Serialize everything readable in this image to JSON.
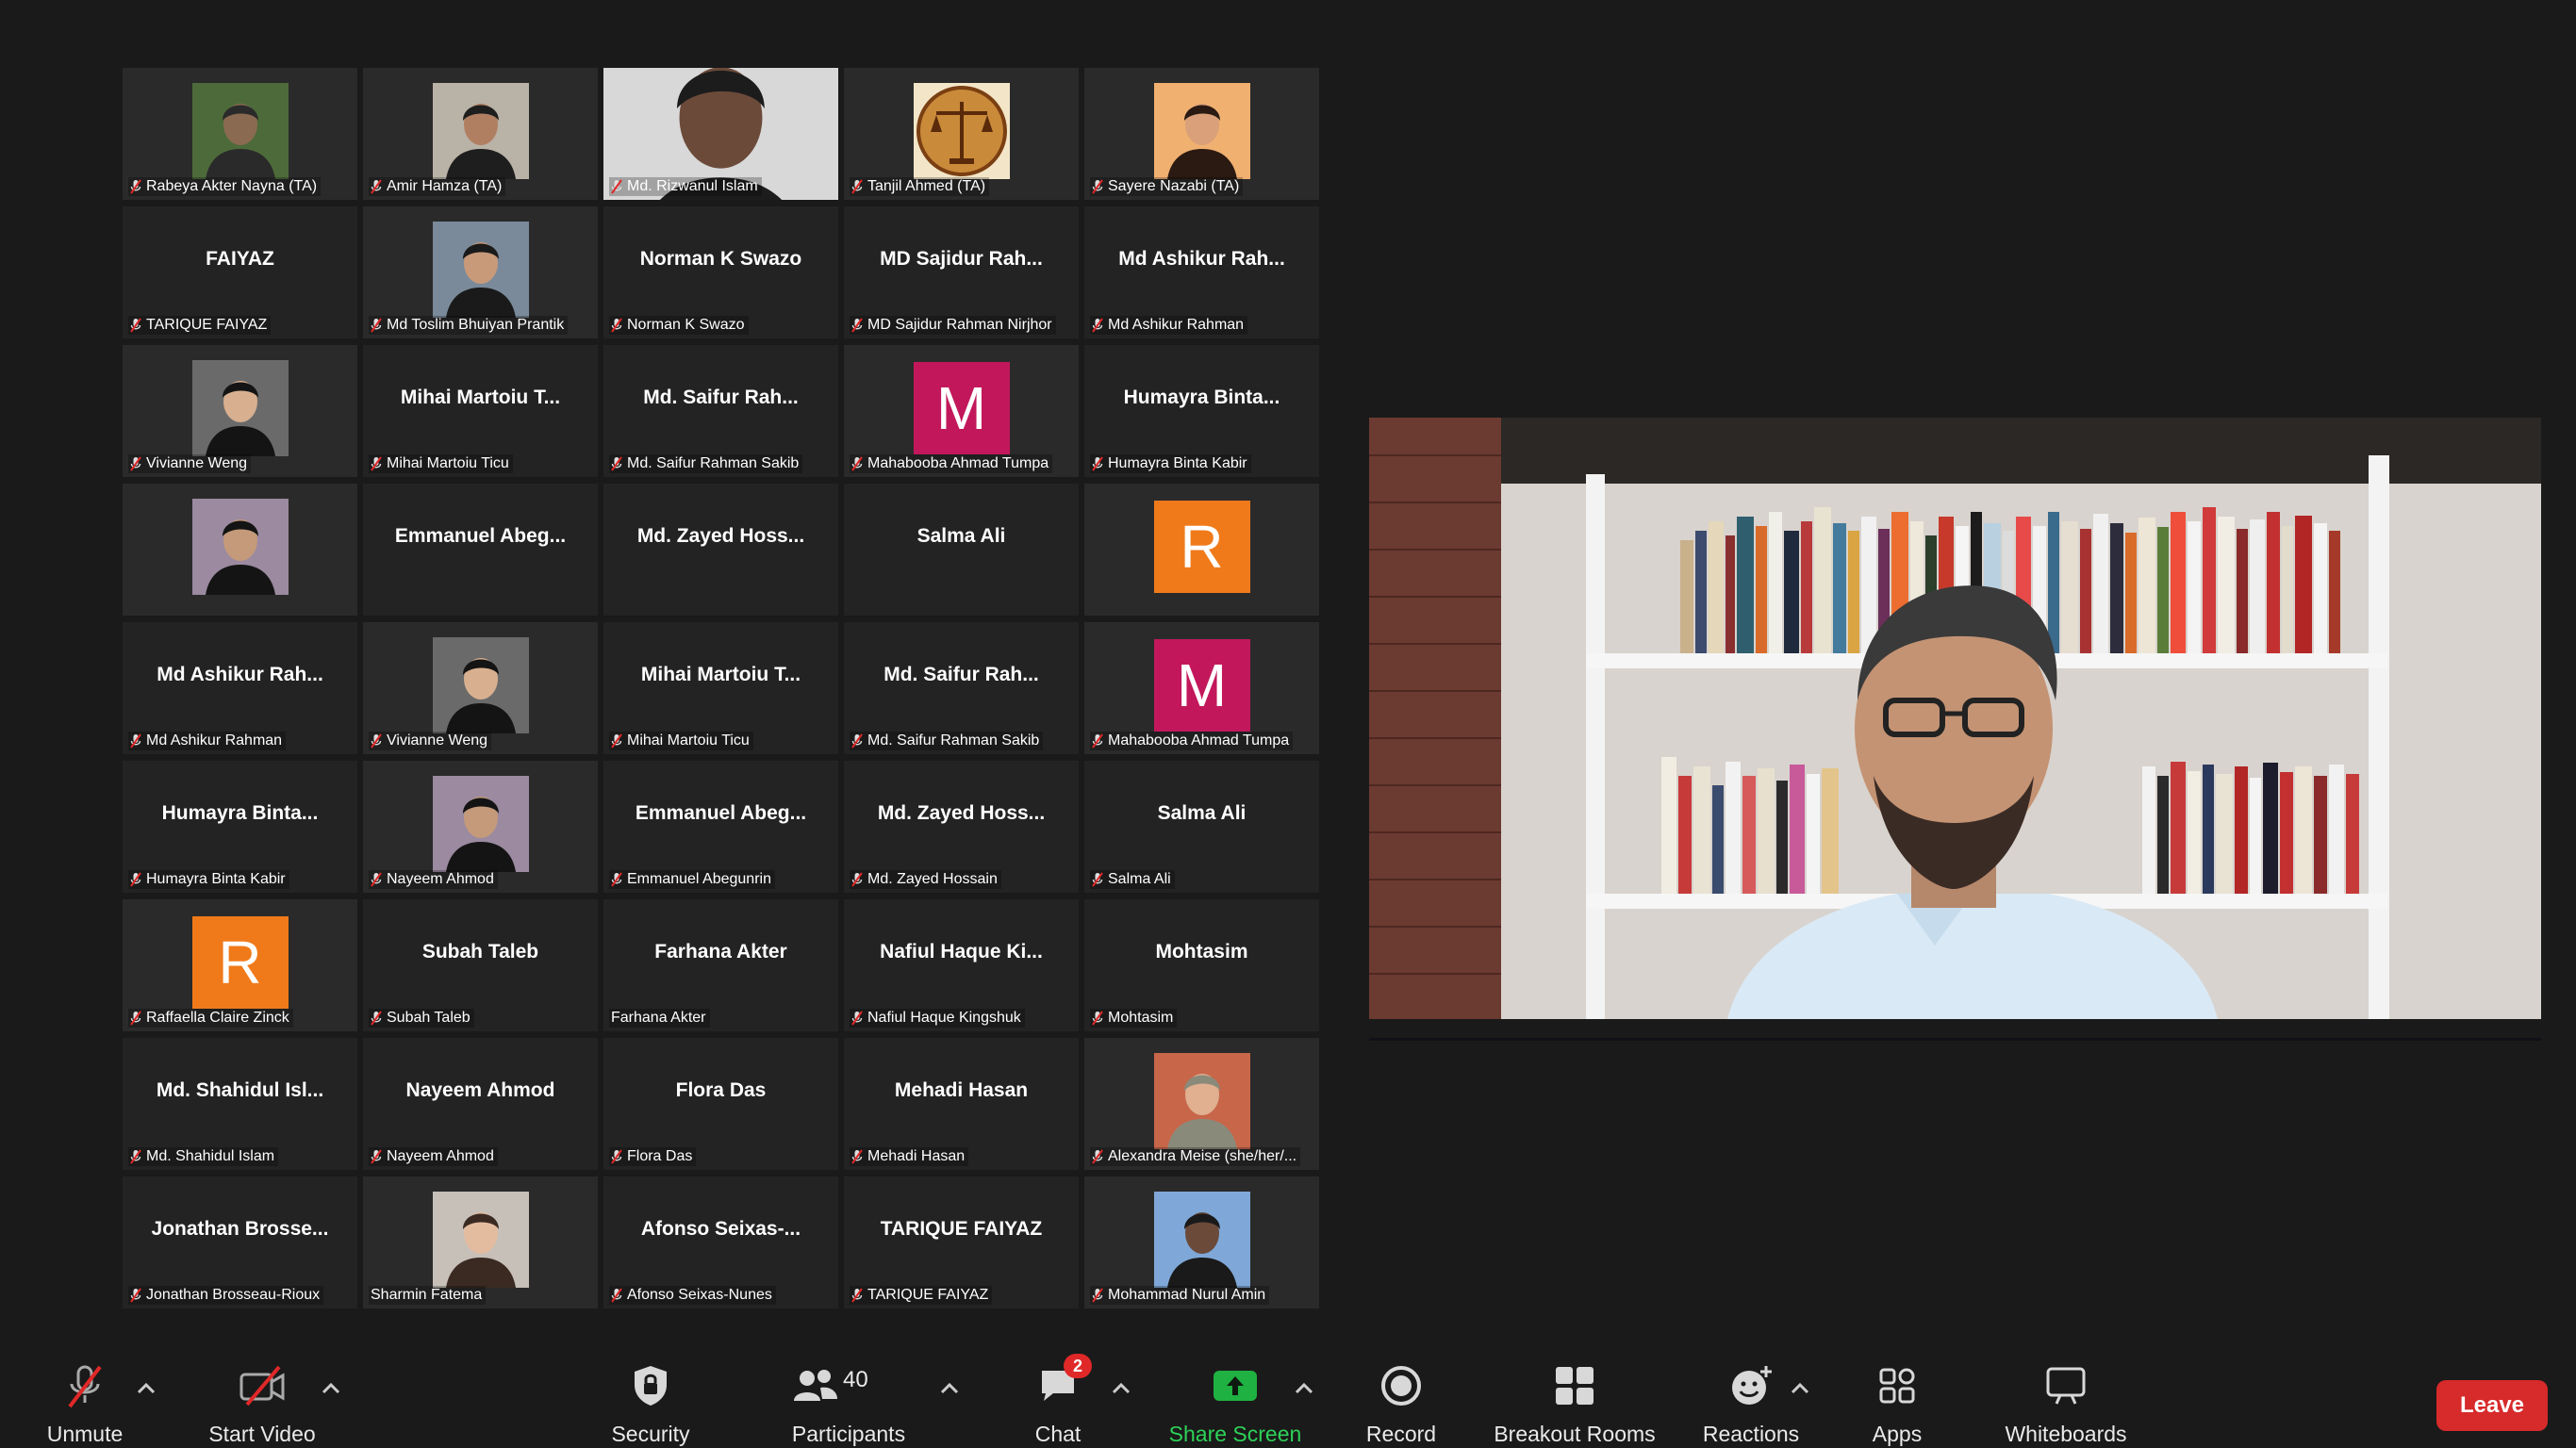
{
  "gallery": [
    {
      "display": "",
      "label": "Rabeya Akter Nayna (TA)",
      "muted": true,
      "photo": "person-outdoor"
    },
    {
      "display": "",
      "label": "Amir Hamza (TA)",
      "muted": true,
      "photo": "person-young-man"
    },
    {
      "display": "",
      "label": "Md. Rizwanul Islam",
      "muted": true,
      "photo": "person-headset-video"
    },
    {
      "display": "",
      "label": "Tanjil Ahmed (TA)",
      "muted": true,
      "photo": "justice-scales-logo"
    },
    {
      "display": "",
      "label": "Sayere Nazabi (TA)",
      "muted": true,
      "photo": "person-woman-portrait"
    },
    {
      "display": "FAIYAZ",
      "label": "TARIQUE FAIYAZ",
      "muted": true
    },
    {
      "display": "",
      "label": "Md Toslim Bhuiyan Prantik",
      "muted": true,
      "photo": "person-glasses"
    },
    {
      "display": "Norman K Swazo",
      "label": "Norman K Swazo",
      "muted": true
    },
    {
      "display": "MD Sajidur Rah...",
      "label": "MD Sajidur Rahman Nirjhor",
      "muted": true
    },
    {
      "display": "Md Ashikur Rah...",
      "label": "Md Ashikur Rahman",
      "muted": true
    },
    {
      "display": "",
      "label": "Vivianne Weng",
      "muted": true,
      "photo": "person-woman-dark-hair"
    },
    {
      "display": "Mihai Martoiu T...",
      "label": "Mihai Martoiu Ticu",
      "muted": true
    },
    {
      "display": "Md. Saifur Rah...",
      "label": "Md. Saifur Rahman Sakib",
      "muted": true
    },
    {
      "display": "",
      "label": "Mahabooba Ahmad Tumpa",
      "muted": true,
      "letter": "M",
      "letter_color": "#c2185b"
    },
    {
      "display": "Humayra Binta...",
      "label": "Humayra Binta Kabir",
      "muted": true
    },
    {
      "display": "",
      "label": "",
      "muted": false,
      "photo": "person-suit"
    },
    {
      "display": "Emmanuel Abeg...",
      "label": "",
      "muted": false
    },
    {
      "display": "Md. Zayed Hoss...",
      "label": "",
      "muted": false
    },
    {
      "display": "Salma Ali",
      "label": "",
      "muted": false
    },
    {
      "display": "",
      "label": "",
      "muted": false,
      "letter": "R",
      "letter_color": "#f07a1a"
    },
    {
      "display": "Md Ashikur Rah...",
      "label": "Md Ashikur Rahman",
      "muted": true
    },
    {
      "display": "",
      "label": "Vivianne Weng",
      "muted": true,
      "photo": "person-woman-dark-hair"
    },
    {
      "display": "Mihai Martoiu T...",
      "label": "Mihai Martoiu Ticu",
      "muted": true
    },
    {
      "display": "Md. Saifur Rah...",
      "label": "Md. Saifur Rahman Sakib",
      "muted": true
    },
    {
      "display": "",
      "label": "Mahabooba Ahmad Tumpa",
      "muted": true,
      "letter": "M",
      "letter_color": "#c2185b"
    },
    {
      "display": "Humayra Binta...",
      "label": "Humayra Binta Kabir",
      "muted": true
    },
    {
      "display": "",
      "label": "Nayeem Ahmod",
      "muted": true,
      "photo": "person-suit"
    },
    {
      "display": "Emmanuel Abeg...",
      "label": "Emmanuel Abegunrin",
      "muted": true
    },
    {
      "display": "Md. Zayed Hoss...",
      "label": "Md. Zayed Hossain",
      "muted": true
    },
    {
      "display": "Salma Ali",
      "label": "Salma Ali",
      "muted": true
    },
    {
      "display": "",
      "label": "Raffaella Claire Zinck",
      "muted": true,
      "letter": "R",
      "letter_color": "#f07a1a"
    },
    {
      "display": "Subah Taleb",
      "label": "Subah Taleb",
      "muted": true
    },
    {
      "display": "Farhana Akter",
      "label": "Farhana Akter",
      "muted": false
    },
    {
      "display": "Nafiul Haque Ki...",
      "label": "Nafiul Haque Kingshuk",
      "muted": true
    },
    {
      "display": "Mohtasim",
      "label": "Mohtasim",
      "muted": true
    },
    {
      "display": "Md. Shahidul Isl...",
      "label": "Md. Shahidul Islam",
      "muted": true
    },
    {
      "display": "Nayeem Ahmod",
      "label": "Nayeem Ahmod",
      "muted": true
    },
    {
      "display": "Flora Das",
      "label": "Flora Das",
      "muted": true
    },
    {
      "display": "Mehadi Hasan",
      "label": "Mehadi Hasan",
      "muted": true
    },
    {
      "display": "",
      "label": "Alexandra Meise (she/her/...",
      "muted": true,
      "photo": "person-older-woman"
    },
    {
      "display": "Jonathan Brosse...",
      "label": "Jonathan Brosseau-Rioux",
      "muted": true
    },
    {
      "display": "",
      "label": "Sharmin Fatema",
      "muted": false,
      "photo": "person-woman-long-hair"
    },
    {
      "display": "Afonso Seixas-...",
      "label": "Afonso Seixas-Nunes",
      "muted": true
    },
    {
      "display": "TARIQUE FAIYAZ",
      "label": "TARIQUE FAIYAZ",
      "muted": true
    },
    {
      "display": "",
      "label": "Mohammad Nurul Amin",
      "muted": true,
      "photo": "person-city-ferris-wheel"
    }
  ],
  "speaker": {
    "description_icon": "speaker-video"
  },
  "toolbar": {
    "unmute": "Unmute",
    "start_video": "Start Video",
    "security": "Security",
    "participants": "Participants",
    "participants_count": "40",
    "chat": "Chat",
    "chat_badge": "2",
    "share_screen": "Share Screen",
    "record": "Record",
    "breakout_rooms": "Breakout Rooms",
    "reactions": "Reactions",
    "apps": "Apps",
    "whiteboards": "Whiteboards",
    "leave": "Leave"
  },
  "colors": {
    "background": "#1a1a1a",
    "tile": "#232323",
    "share_green": "#1fb141",
    "leave_red": "#d72a2a",
    "muted_red": "#e02828"
  }
}
